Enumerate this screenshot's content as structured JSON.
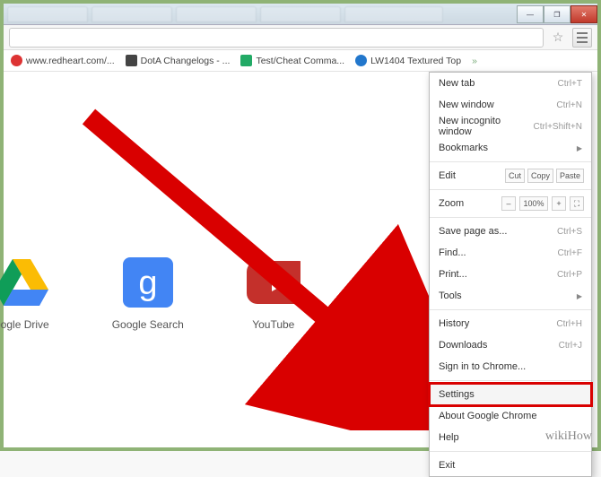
{
  "window": {
    "min": "—",
    "max": "❐",
    "close": "✕"
  },
  "toolbar": {
    "star": "☆"
  },
  "bookmarks": [
    {
      "label": "www.redheart.com/...",
      "color": "#d33"
    },
    {
      "label": "DotA Changelogs - ...",
      "color": "#333"
    },
    {
      "label": "Test/Cheat Comma...",
      "color": "#2a6"
    },
    {
      "label": "LW1404 Textured Top",
      "color": "#27c"
    }
  ],
  "tiles": [
    {
      "label": "oogle Drive"
    },
    {
      "label": "Google Search"
    },
    {
      "label": "YouTube"
    }
  ],
  "menu": {
    "new_tab": "New tab",
    "new_tab_sc": "Ctrl+T",
    "new_win": "New window",
    "new_win_sc": "Ctrl+N",
    "incog": "New incognito window",
    "incog_sc": "Ctrl+Shift+N",
    "bookmarks": "Bookmarks",
    "edit": "Edit",
    "cut": "Cut",
    "copy": "Copy",
    "paste": "Paste",
    "zoom": "Zoom",
    "zoom_val": "100%",
    "minus": "–",
    "plus": "+",
    "save": "Save page as...",
    "save_sc": "Ctrl+S",
    "find": "Find...",
    "find_sc": "Ctrl+F",
    "print": "Print...",
    "print_sc": "Ctrl+P",
    "tools": "Tools",
    "history": "History",
    "history_sc": "Ctrl+H",
    "downloads": "Downloads",
    "downloads_sc": "Ctrl+J",
    "signin": "Sign in to Chrome...",
    "settings": "Settings",
    "about": "About Google Chrome",
    "help": "Help",
    "exit": "Exit"
  },
  "watermark": "wikiHow"
}
